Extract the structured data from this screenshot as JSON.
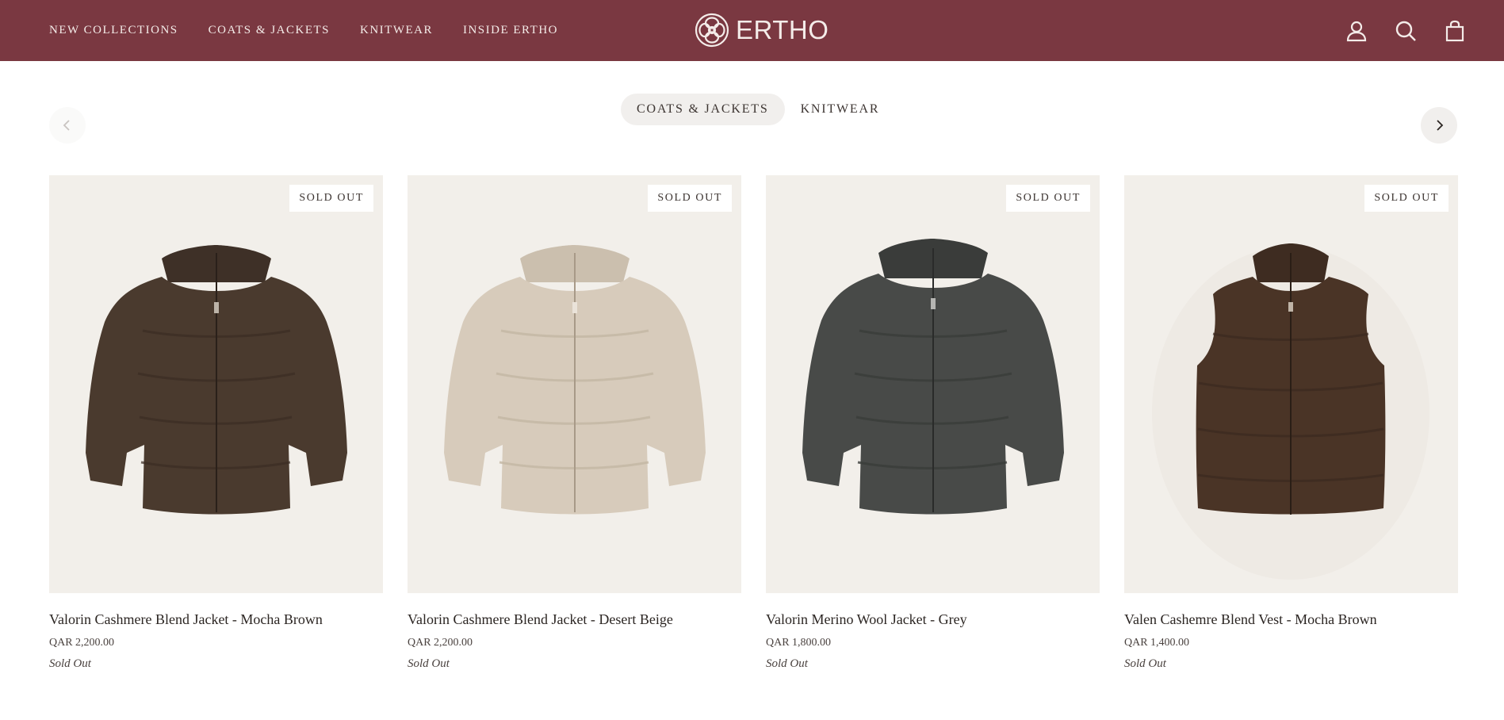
{
  "header": {
    "nav": [
      "NEW COLLECTIONS",
      "COATS & JACKETS",
      "KNITWEAR",
      "INSIDE ERTHO"
    ],
    "logo_text": "ERTHO",
    "bg_color": "#7a3841",
    "icons": [
      "account-icon",
      "search-icon",
      "cart-icon"
    ]
  },
  "tabs": [
    {
      "label": "COATS & JACKETS",
      "active": true
    },
    {
      "label": "KNITWEAR",
      "active": false
    }
  ],
  "carousel": {
    "prev_icon": "chevron-left-icon",
    "next_icon": "chevron-right-icon"
  },
  "products": [
    {
      "name": "Valorin Cashmere Blend Jacket - Mocha Brown",
      "price": "QAR 2,200.00",
      "status": "Sold Out",
      "badge": "SOLD OUT",
      "color": "#4a3a2e"
    },
    {
      "name": "Valorin Cashmere Blend Jacket - Desert Beige",
      "price": "QAR 2,200.00",
      "status": "Sold Out",
      "badge": "SOLD OUT",
      "color": "#d7cbbb"
    },
    {
      "name": "Valorin Merino Wool Jacket - Grey",
      "price": "QAR 1,800.00",
      "status": "Sold Out",
      "badge": "SOLD OUT",
      "color": "#484a48"
    },
    {
      "name": "Valen Cashemre Blend Vest - Mocha Brown",
      "price": "QAR 1,400.00",
      "status": "Sold Out",
      "badge": "SOLD OUT",
      "color": "#4a3426"
    }
  ]
}
